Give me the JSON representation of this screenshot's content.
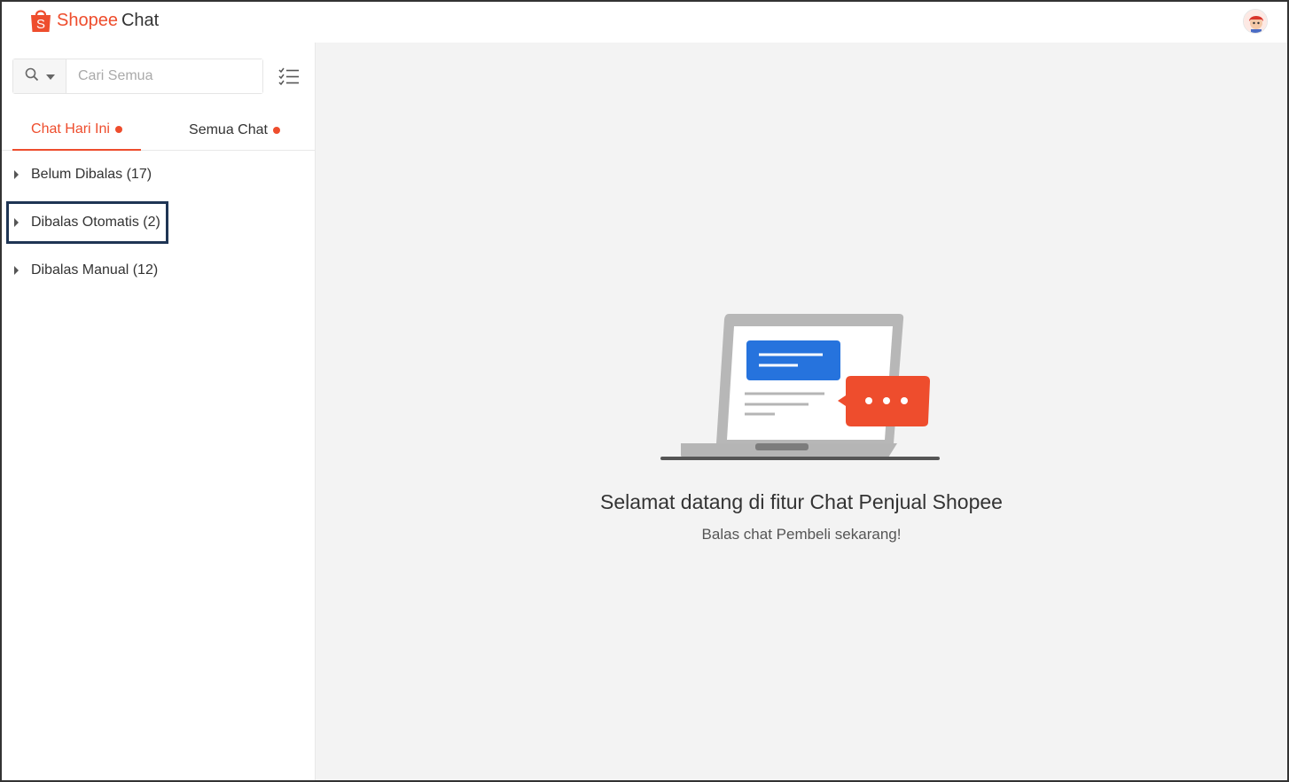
{
  "app": {
    "brand_primary": "Shopee",
    "brand_secondary": "Chat",
    "logo_letter": "S",
    "accent_color": "#ee4d2d"
  },
  "search": {
    "placeholder": "Cari Semua",
    "value": "",
    "scope_icon": "search-icon",
    "filter_icon": "checklist-icon"
  },
  "tabs": [
    {
      "label": "Chat Hari Ini",
      "active": true,
      "has_dot": true
    },
    {
      "label": "Semua Chat",
      "active": false,
      "has_dot": true
    }
  ],
  "groups": [
    {
      "label": "Belum Dibalas (17)"
    },
    {
      "label": "Dibalas Otomatis (2)",
      "highlighted": true
    },
    {
      "label": "Dibalas Manual (12)"
    }
  ],
  "main": {
    "title": "Selamat datang di fitur Chat Penjual Shopee",
    "subtitle": "Balas chat Pembeli sekarang!"
  }
}
